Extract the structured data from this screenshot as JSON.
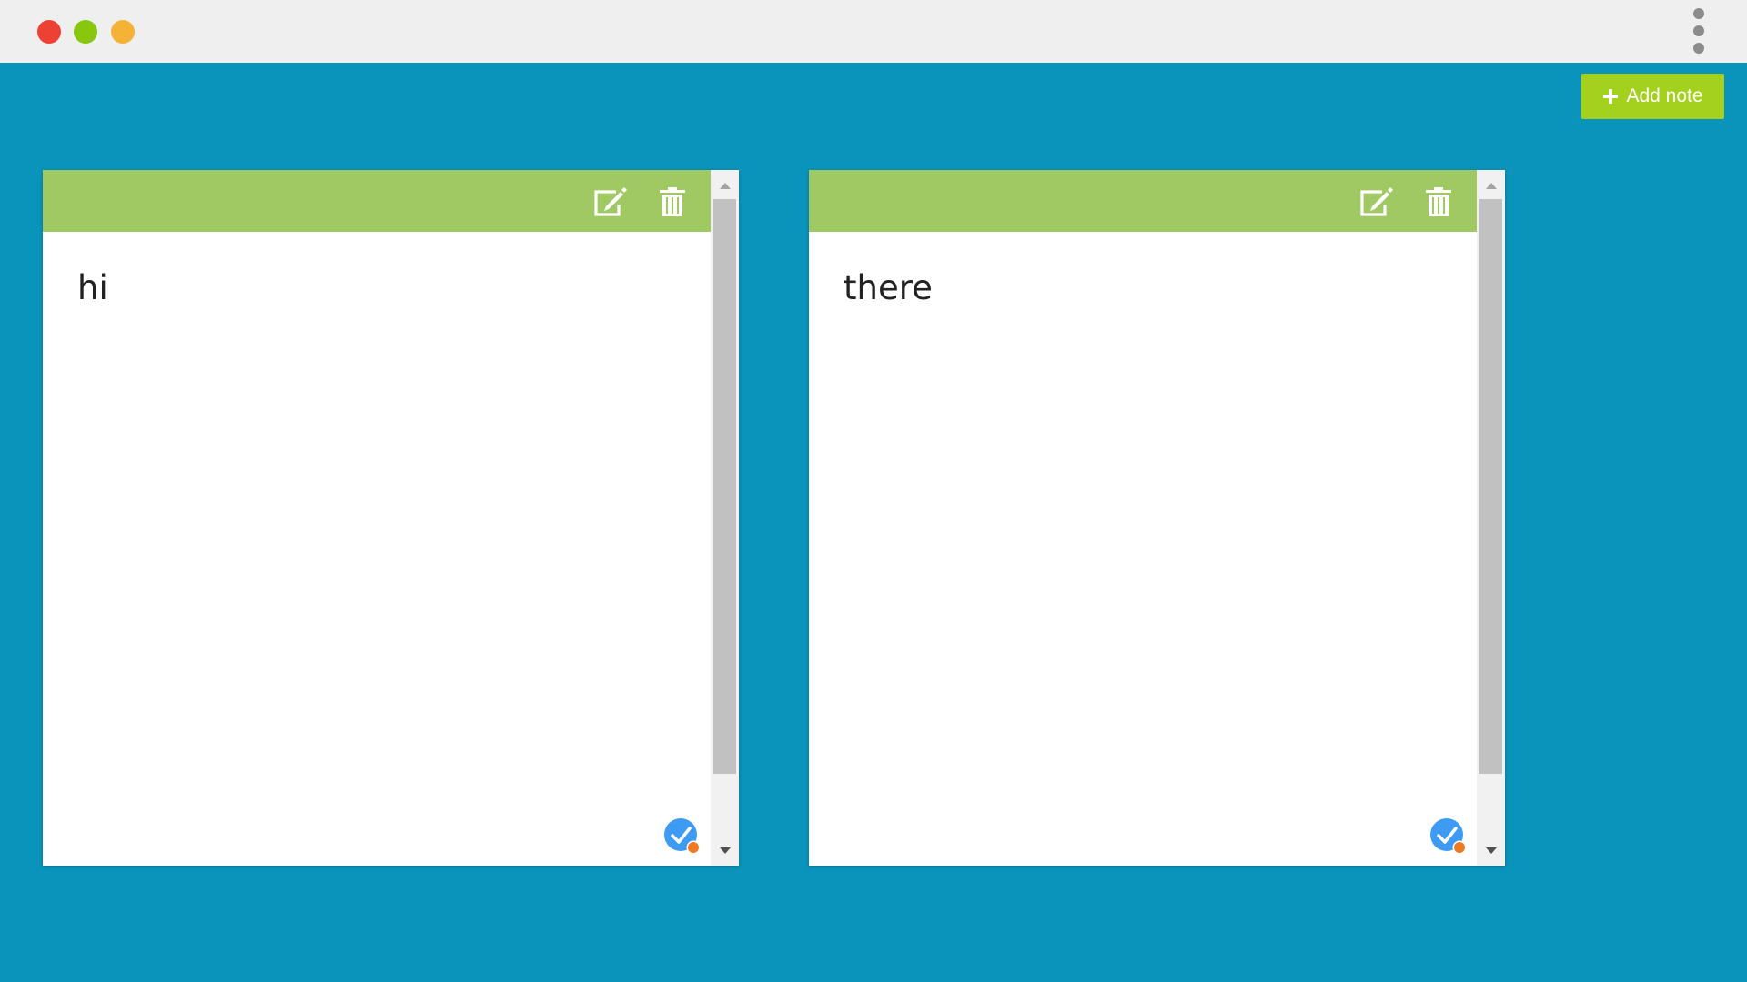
{
  "window": {
    "traffic_colors": {
      "close": "#ed4134",
      "minimize": "#88c70d",
      "maximize": "#f4b237"
    }
  },
  "toolbar": {
    "add_note_label": "Add note",
    "add_note_color": "#a4d11d"
  },
  "theme": {
    "background": "#0b94bb",
    "note_header": "#a0c963",
    "status_blue": "#3d9bf3",
    "status_orange": "#ef7a24"
  },
  "notes": [
    {
      "text": "hi",
      "edit_icon": "edit-icon",
      "delete_icon": "trash-icon",
      "status_icon": "check-circle-icon"
    },
    {
      "text": "there",
      "edit_icon": "edit-icon",
      "delete_icon": "trash-icon",
      "status_icon": "check-circle-icon"
    }
  ]
}
